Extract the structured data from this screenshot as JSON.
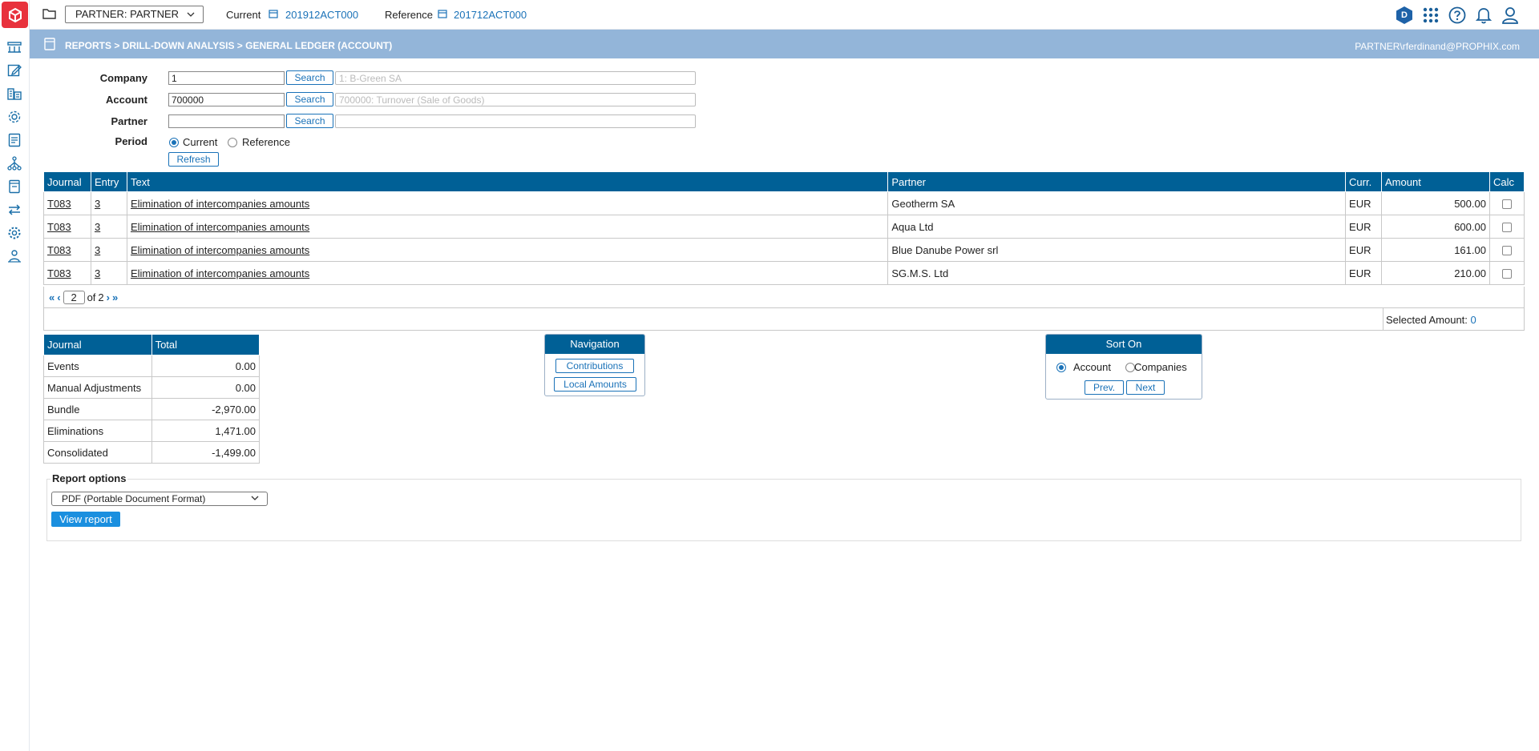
{
  "topbar": {
    "partner_select": "PARTNER: PARTNER",
    "current_label": "Current",
    "current_value": "201912ACT000",
    "reference_label": "Reference",
    "reference_value": "201712ACT000",
    "user_badge": "D"
  },
  "breadcrumb": {
    "path": "REPORTS > DRILL-DOWN ANALYSIS > GENERAL LEDGER (ACCOUNT)",
    "user": "PARTNER\\rferdinand@PROPHIX.com"
  },
  "form": {
    "company_label": "Company",
    "company_value": "1",
    "company_desc": "1: B-Green SA",
    "account_label": "Account",
    "account_value": "700000",
    "account_desc": "700000: Turnover (Sale of Goods)",
    "partner_label": "Partner",
    "partner_value": "",
    "partner_desc": "",
    "search_label": "Search",
    "period_label": "Period",
    "period_current": "Current",
    "period_reference": "Reference",
    "refresh_label": "Refresh"
  },
  "ledger": {
    "headers": {
      "journal": "Journal",
      "entry": "Entry",
      "text": "Text",
      "partner": "Partner",
      "curr": "Curr.",
      "amount": "Amount",
      "calc": "Calc"
    },
    "rows": [
      {
        "journal": "T083",
        "entry": "3",
        "text": "Elimination of intercompanies amounts",
        "partner": "Geotherm SA",
        "curr": "EUR",
        "amount": "500.00"
      },
      {
        "journal": "T083",
        "entry": "3",
        "text": "Elimination of intercompanies amounts",
        "partner": "Aqua Ltd",
        "curr": "EUR",
        "amount": "600.00"
      },
      {
        "journal": "T083",
        "entry": "3",
        "text": "Elimination of intercompanies amounts",
        "partner": "Blue Danube Power srl",
        "curr": "EUR",
        "amount": "161.00"
      },
      {
        "journal": "T083",
        "entry": "3",
        "text": "Elimination of intercompanies amounts",
        "partner": "SG.M.S. Ltd",
        "curr": "EUR",
        "amount": "210.00"
      }
    ],
    "pager": {
      "first": "«",
      "prev": "‹",
      "page": "2",
      "of": "of",
      "total": "2",
      "next": "›",
      "last": "»"
    },
    "selected_amount_label": "Selected Amount:",
    "selected_amount_value": "0"
  },
  "totals": {
    "headers": {
      "journal": "Journal",
      "total": "Total"
    },
    "rows": [
      {
        "label": "Events",
        "value": "0.00"
      },
      {
        "label": "Manual Adjustments",
        "value": "0.00"
      },
      {
        "label": "Bundle",
        "value": "-2,970.00"
      },
      {
        "label": "Eliminations",
        "value": "1,471.00"
      },
      {
        "label": "Consolidated",
        "value": "-1,499.00"
      }
    ]
  },
  "navigation": {
    "title": "Navigation",
    "contributions": "Contributions",
    "local_amounts": "Local Amounts"
  },
  "sort_on": {
    "title": "Sort On",
    "account": "Account",
    "companies": "Companies",
    "prev": "Prev.",
    "next": "Next"
  },
  "report_options": {
    "legend": "Report options",
    "format": "PDF (Portable Document Format)",
    "view_button": "View report"
  },
  "colors": {
    "brand_red": "#e8313c",
    "table_header": "#006096",
    "breadcrumb_bar": "#93b5d9",
    "link_blue": "#1a72b8"
  }
}
